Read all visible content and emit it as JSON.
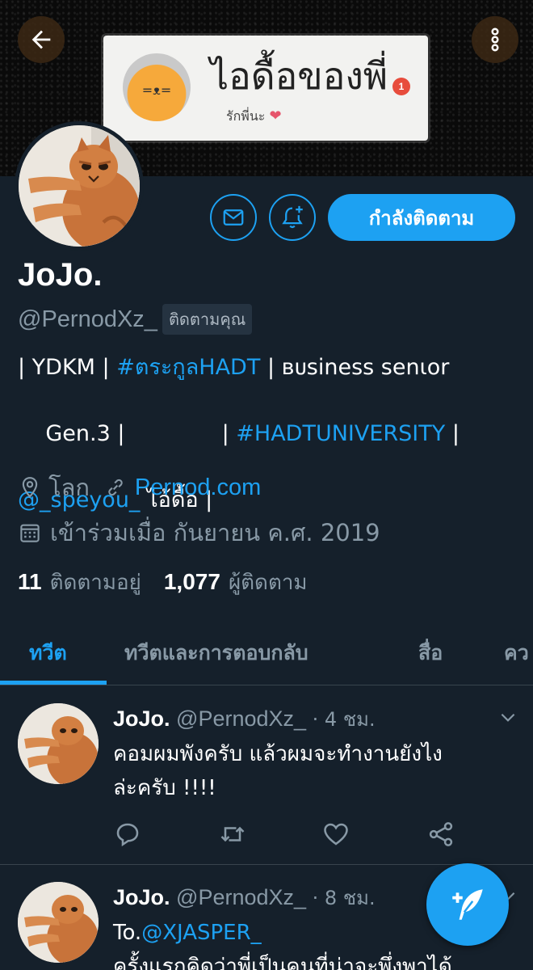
{
  "banner": {
    "title": "ไอดื้อของพี่",
    "subtitle": "รักพี่นะ",
    "badge": "1",
    "heart": "❤"
  },
  "header": {
    "back_icon": "arrow-left-icon",
    "more_icon": "more-vertical-icon"
  },
  "profile": {
    "name": "JoJo.",
    "handle": "@PernodXz_",
    "follows_you": "ติดตามคุณ",
    "bio_line1_a": "| YDKM | ",
    "bio_line1_link": "#ตระกูลHADT",
    "bio_line1_b": " | ʙᴜsiness senιor",
    "bio_line2_a": "Gen.3 |              | ",
    "bio_line2_link": "#HADTUNIVERSITY",
    "bio_line2_b": " |",
    "bio_line3_link": "@_speyou_",
    "bio_line3_b": " ไอ้ดื้อ |",
    "location": "โลก",
    "website": "Pernod.com",
    "joined": "เข้าร่วมเมื่อ กันยายน ค.ศ. 2019",
    "following_count": "11",
    "following_label": "ติดตามอยู่",
    "followers_count": "1,077",
    "followers_label": "ผู้ติดตาม",
    "follow_button": "กำลังติดตาม"
  },
  "tabs": [
    {
      "label": "ทวีต",
      "active": true
    },
    {
      "label": "ทวีตและการตอบกลับ",
      "active": false
    },
    {
      "label": "สื่อ",
      "active": false
    },
    {
      "label": "คว",
      "active": false
    }
  ],
  "tweets": [
    {
      "name": "JoJo.",
      "handle": "@PernodXz_",
      "time": " · 4 ชม.",
      "text_line1": "คอมผมพังครับ แล้วผมจะทำงานยังไง",
      "text_line2": "ล่ะครับ !!!!"
    },
    {
      "name": "JoJo.",
      "handle": "@PernodXz_",
      "time": " · 8 ชม.",
      "text_prefix": "To.",
      "text_link": "@XJASPER_",
      "text_line2": "ครั้งแรกคิดว่าพี่เป็นคนที่น่าจะพึ่งพาได้"
    }
  ],
  "colors": {
    "background": "#15202b",
    "accent": "#1da1f2",
    "secondary_text": "#8899a6",
    "divider": "#38444d"
  }
}
